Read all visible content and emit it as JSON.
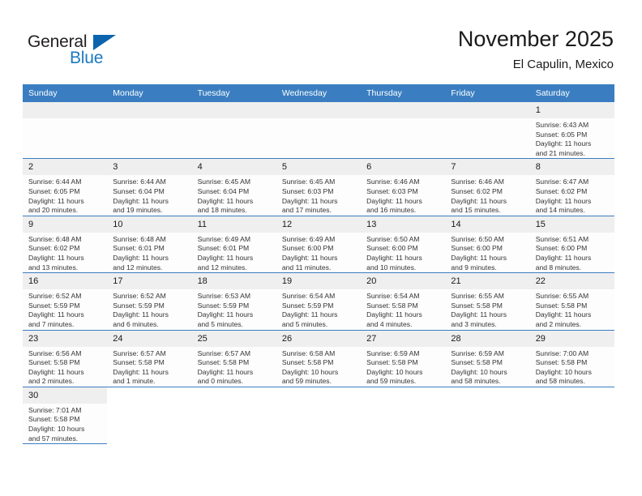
{
  "brand": {
    "name_top": "General",
    "name_bottom": "Blue",
    "flag_icon": "triangle-flag-icon",
    "accent_color": "#1b79c0"
  },
  "header": {
    "title": "November 2025",
    "location": "El Capulin, Mexico"
  },
  "calendar": {
    "header_color": "#3a7ec1",
    "weekdays": [
      "Sunday",
      "Monday",
      "Tuesday",
      "Wednesday",
      "Thursday",
      "Friday",
      "Saturday"
    ],
    "weeks": [
      [
        {
          "day": "",
          "lines": []
        },
        {
          "day": "",
          "lines": []
        },
        {
          "day": "",
          "lines": []
        },
        {
          "day": "",
          "lines": []
        },
        {
          "day": "",
          "lines": []
        },
        {
          "day": "",
          "lines": []
        },
        {
          "day": "1",
          "lines": [
            "Sunrise: 6:43 AM",
            "Sunset: 6:05 PM",
            "Daylight: 11 hours",
            "and 21 minutes."
          ]
        }
      ],
      [
        {
          "day": "2",
          "lines": [
            "Sunrise: 6:44 AM",
            "Sunset: 6:05 PM",
            "Daylight: 11 hours",
            "and 20 minutes."
          ]
        },
        {
          "day": "3",
          "lines": [
            "Sunrise: 6:44 AM",
            "Sunset: 6:04 PM",
            "Daylight: 11 hours",
            "and 19 minutes."
          ]
        },
        {
          "day": "4",
          "lines": [
            "Sunrise: 6:45 AM",
            "Sunset: 6:04 PM",
            "Daylight: 11 hours",
            "and 18 minutes."
          ]
        },
        {
          "day": "5",
          "lines": [
            "Sunrise: 6:45 AM",
            "Sunset: 6:03 PM",
            "Daylight: 11 hours",
            "and 17 minutes."
          ]
        },
        {
          "day": "6",
          "lines": [
            "Sunrise: 6:46 AM",
            "Sunset: 6:03 PM",
            "Daylight: 11 hours",
            "and 16 minutes."
          ]
        },
        {
          "day": "7",
          "lines": [
            "Sunrise: 6:46 AM",
            "Sunset: 6:02 PM",
            "Daylight: 11 hours",
            "and 15 minutes."
          ]
        },
        {
          "day": "8",
          "lines": [
            "Sunrise: 6:47 AM",
            "Sunset: 6:02 PM",
            "Daylight: 11 hours",
            "and 14 minutes."
          ]
        }
      ],
      [
        {
          "day": "9",
          "lines": [
            "Sunrise: 6:48 AM",
            "Sunset: 6:02 PM",
            "Daylight: 11 hours",
            "and 13 minutes."
          ]
        },
        {
          "day": "10",
          "lines": [
            "Sunrise: 6:48 AM",
            "Sunset: 6:01 PM",
            "Daylight: 11 hours",
            "and 12 minutes."
          ]
        },
        {
          "day": "11",
          "lines": [
            "Sunrise: 6:49 AM",
            "Sunset: 6:01 PM",
            "Daylight: 11 hours",
            "and 12 minutes."
          ]
        },
        {
          "day": "12",
          "lines": [
            "Sunrise: 6:49 AM",
            "Sunset: 6:00 PM",
            "Daylight: 11 hours",
            "and 11 minutes."
          ]
        },
        {
          "day": "13",
          "lines": [
            "Sunrise: 6:50 AM",
            "Sunset: 6:00 PM",
            "Daylight: 11 hours",
            "and 10 minutes."
          ]
        },
        {
          "day": "14",
          "lines": [
            "Sunrise: 6:50 AM",
            "Sunset: 6:00 PM",
            "Daylight: 11 hours",
            "and 9 minutes."
          ]
        },
        {
          "day": "15",
          "lines": [
            "Sunrise: 6:51 AM",
            "Sunset: 6:00 PM",
            "Daylight: 11 hours",
            "and 8 minutes."
          ]
        }
      ],
      [
        {
          "day": "16",
          "lines": [
            "Sunrise: 6:52 AM",
            "Sunset: 5:59 PM",
            "Daylight: 11 hours",
            "and 7 minutes."
          ]
        },
        {
          "day": "17",
          "lines": [
            "Sunrise: 6:52 AM",
            "Sunset: 5:59 PM",
            "Daylight: 11 hours",
            "and 6 minutes."
          ]
        },
        {
          "day": "18",
          "lines": [
            "Sunrise: 6:53 AM",
            "Sunset: 5:59 PM",
            "Daylight: 11 hours",
            "and 5 minutes."
          ]
        },
        {
          "day": "19",
          "lines": [
            "Sunrise: 6:54 AM",
            "Sunset: 5:59 PM",
            "Daylight: 11 hours",
            "and 5 minutes."
          ]
        },
        {
          "day": "20",
          "lines": [
            "Sunrise: 6:54 AM",
            "Sunset: 5:58 PM",
            "Daylight: 11 hours",
            "and 4 minutes."
          ]
        },
        {
          "day": "21",
          "lines": [
            "Sunrise: 6:55 AM",
            "Sunset: 5:58 PM",
            "Daylight: 11 hours",
            "and 3 minutes."
          ]
        },
        {
          "day": "22",
          "lines": [
            "Sunrise: 6:55 AM",
            "Sunset: 5:58 PM",
            "Daylight: 11 hours",
            "and 2 minutes."
          ]
        }
      ],
      [
        {
          "day": "23",
          "lines": [
            "Sunrise: 6:56 AM",
            "Sunset: 5:58 PM",
            "Daylight: 11 hours",
            "and 2 minutes."
          ]
        },
        {
          "day": "24",
          "lines": [
            "Sunrise: 6:57 AM",
            "Sunset: 5:58 PM",
            "Daylight: 11 hours",
            "and 1 minute."
          ]
        },
        {
          "day": "25",
          "lines": [
            "Sunrise: 6:57 AM",
            "Sunset: 5:58 PM",
            "Daylight: 11 hours",
            "and 0 minutes."
          ]
        },
        {
          "day": "26",
          "lines": [
            "Sunrise: 6:58 AM",
            "Sunset: 5:58 PM",
            "Daylight: 10 hours",
            "and 59 minutes."
          ]
        },
        {
          "day": "27",
          "lines": [
            "Sunrise: 6:59 AM",
            "Sunset: 5:58 PM",
            "Daylight: 10 hours",
            "and 59 minutes."
          ]
        },
        {
          "day": "28",
          "lines": [
            "Sunrise: 6:59 AM",
            "Sunset: 5:58 PM",
            "Daylight: 10 hours",
            "and 58 minutes."
          ]
        },
        {
          "day": "29",
          "lines": [
            "Sunrise: 7:00 AM",
            "Sunset: 5:58 PM",
            "Daylight: 10 hours",
            "and 58 minutes."
          ]
        }
      ],
      [
        {
          "day": "30",
          "lines": [
            "Sunrise: 7:01 AM",
            "Sunset: 5:58 PM",
            "Daylight: 10 hours",
            "and 57 minutes."
          ]
        },
        {
          "day": null,
          "lines": []
        },
        {
          "day": null,
          "lines": []
        },
        {
          "day": null,
          "lines": []
        },
        {
          "day": null,
          "lines": []
        },
        {
          "day": null,
          "lines": []
        },
        {
          "day": null,
          "lines": []
        }
      ]
    ]
  }
}
